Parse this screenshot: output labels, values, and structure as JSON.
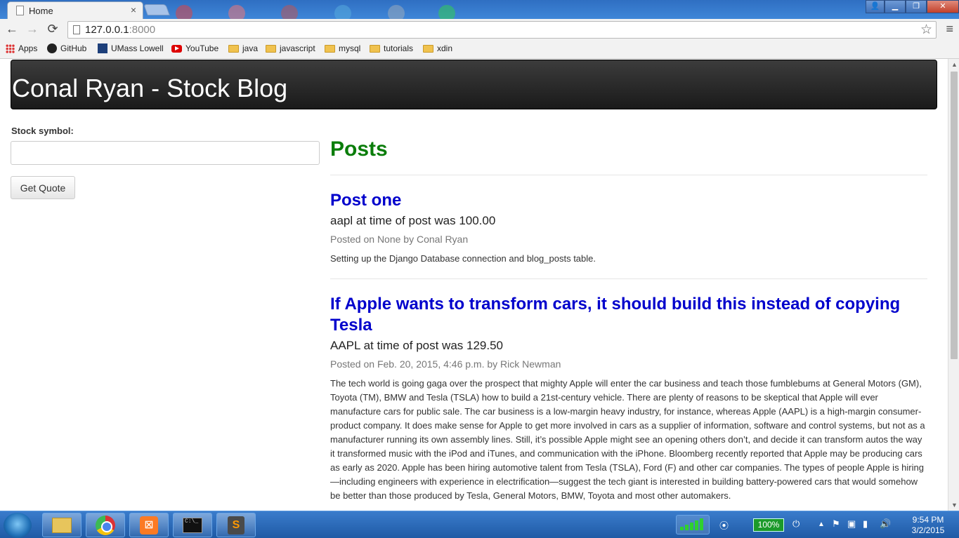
{
  "browser": {
    "tab_title": "Home",
    "tab_close": "×",
    "url_host": "127.0.0.1",
    "url_port": ":8000",
    "back": "←",
    "forward": "→",
    "reload": "⟳",
    "star": "☆",
    "menu": "≡"
  },
  "window_controls": {
    "minimize": "▁",
    "maximize": "❐",
    "close": "✕"
  },
  "bookmarks": [
    {
      "label": "Apps",
      "icon": "apps-grid-icon"
    },
    {
      "label": "GitHub",
      "icon": "github-icon"
    },
    {
      "label": "UMass Lowell",
      "icon": "umass-lowell-icon"
    },
    {
      "label": "YouTube",
      "icon": "youtube-icon"
    },
    {
      "label": "java",
      "icon": "folder-icon"
    },
    {
      "label": "javascript",
      "icon": "folder-icon"
    },
    {
      "label": "mysql",
      "icon": "folder-icon"
    },
    {
      "label": "tutorials",
      "icon": "folder-icon"
    },
    {
      "label": "xdin",
      "icon": "folder-icon"
    }
  ],
  "page": {
    "header_title": "Conal Ryan - Stock Blog",
    "stock_label": "Stock symbol:",
    "stock_input_value": "",
    "quote_button": "Get Quote",
    "posts_heading": "Posts",
    "posts": [
      {
        "title": "Post one",
        "price_line": "aapl at time of post was 100.00",
        "meta": "Posted on None by Conal Ryan",
        "body": "Setting up the Django Database connection and blog_posts table."
      },
      {
        "title": "If Apple wants to transform cars, it should build this instead of copying Tesla",
        "price_line": "AAPL at time of post was 129.50",
        "meta": "Posted on Feb. 20, 2015, 4:46 p.m. by Rick Newman",
        "body": "The tech world is going gaga over the prospect that mighty Apple will enter the car business and teach those fumblebums at General Motors (GM), Toyota (TM), BMW and Tesla (TSLA) how to build a 21st-century vehicle. There are plenty of reasons to be skeptical that Apple will ever manufacture cars for public sale. The car business is a low-margin heavy industry, for instance, whereas Apple (AAPL) is a high-margin consumer-product company. It does make sense for Apple to get more involved in cars as a supplier of information, software and control systems, but not as a manufacturer running its own assembly lines. Still, it’s possible Apple might see an opening others don’t, and decide it can transform autos the way it transformed music with the iPod and iTunes, and communication with the iPhone. Bloomberg recently reported that Apple may be producing cars as early as 2020. Apple has been hiring automotive talent from Tesla (TSLA), Ford (F) and other car companies. The types of people Apple is hiring—including engineers with experience in electrification—suggest the tech giant is interested in building battery-powered cars that would somehow be better than those produced by Tesla, General Motors, BMW, Toyota and most other automakers."
      }
    ]
  },
  "taskbar": {
    "cmd_text": "C:\\_",
    "xampp_glyph": "⊠",
    "sublime_glyph": "S",
    "battery": "100%",
    "time": "9:54 PM",
    "date": "3/2/2015",
    "apps": [
      "explorer-icon",
      "chrome-icon",
      "xampp-icon",
      "cmd-icon",
      "sublime-text-icon"
    ]
  },
  "colors": {
    "posts_heading": "#0a7d0a",
    "post_title_link": "#0000cc",
    "header_bg": "#222222"
  }
}
